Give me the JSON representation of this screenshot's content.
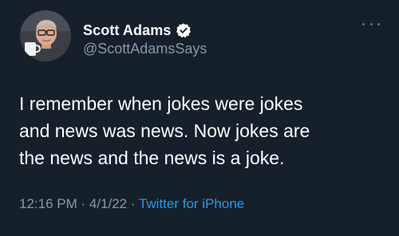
{
  "author": {
    "display_name": "Scott Adams",
    "handle": "@ScottAdamsSays",
    "verified": true,
    "avatar_icon": "profile-photo",
    "verified_icon": "verified-badge-icon"
  },
  "tweet": {
    "text": "I remember when jokes were jokes\nand news was news. Now jokes are\nthe news and the news is a joke."
  },
  "meta": {
    "time": "12:16 PM",
    "separator1": " · ",
    "date": "4/1/22",
    "separator2": " · ",
    "source": "Twitter for iPhone"
  },
  "colors": {
    "background": "#15202b",
    "primary_text": "#ffffff",
    "secondary_text": "#8b98a5",
    "link": "#1d9bf0"
  },
  "menu": {
    "icon": "more-options-icon"
  }
}
